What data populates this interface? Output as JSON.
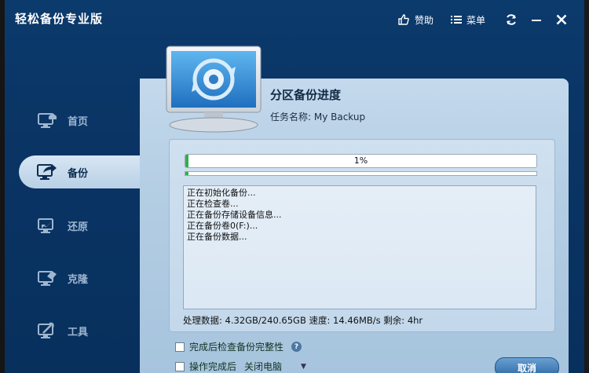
{
  "window": {
    "title": "轻松备份专业版"
  },
  "titlebar": {
    "donate_label": "赞助",
    "menu_label": "菜单"
  },
  "nav": {
    "items": [
      {
        "label": "首页"
      },
      {
        "label": "备份"
      },
      {
        "label": "还原"
      },
      {
        "label": "克隆"
      },
      {
        "label": "工具"
      }
    ]
  },
  "main": {
    "title": "分区备份进度",
    "task_name": "任务名称: My Backup",
    "progress_text": "1%",
    "progress_fraction": 0.01,
    "log_lines": [
      "正在初始化备份...",
      "正在检查卷...",
      "正在备份存储设备信息...",
      "正在备份卷0(F:)...",
      "正在备份数据..."
    ],
    "stats": "处理数据: 4.32GB/240.65GB  速度: 14.46MB/s  剩余: 4hr",
    "options": {
      "verify_label": "完成后检查备份完整性",
      "help_symbol": "?",
      "after_label": "操作完成后",
      "after_value": "关闭电脑"
    },
    "cancel_label": "取消"
  },
  "colors": {
    "window_bg": "#0a3464",
    "content_bg": "#b3cde3",
    "progress_fill": "#32b04a",
    "accent_button": "#2c6aa6"
  }
}
